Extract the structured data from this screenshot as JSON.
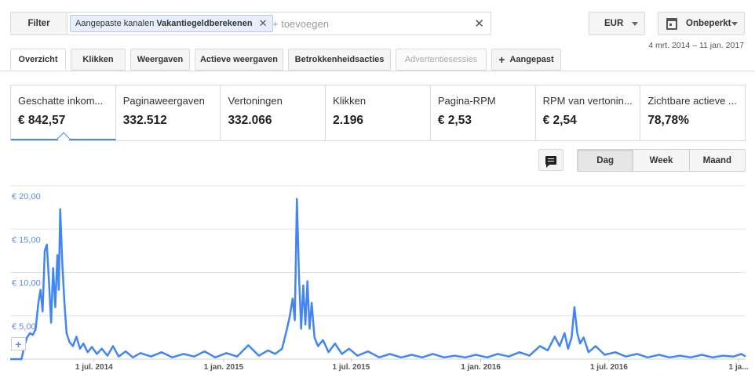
{
  "filter": {
    "button_label": "Filter",
    "chip_prefix": "Aangepaste kanalen",
    "chip_value": "Vakantiegeldberekenen",
    "add_placeholder": "+ toevoegen"
  },
  "currency": {
    "label": "EUR"
  },
  "period": {
    "label": "Onbeperkt",
    "date_range": "4 mrt. 2014 – 11 jan. 2017"
  },
  "tabs": [
    {
      "label": "Overzicht",
      "state": "active"
    },
    {
      "label": "Klikken",
      "state": "normal"
    },
    {
      "label": "Weergaven",
      "state": "normal"
    },
    {
      "label": "Actieve weergaven",
      "state": "normal"
    },
    {
      "label": "Betrokkenheidsacties",
      "state": "normal"
    },
    {
      "label": "Advertentiesessies",
      "state": "disabled"
    },
    {
      "label": "Aangepast",
      "state": "normal"
    }
  ],
  "metrics": [
    {
      "label": "Geschatte inkom...",
      "value": "€ 842,57",
      "selected": true
    },
    {
      "label": "Paginaweergaven",
      "value": "332.512"
    },
    {
      "label": "Vertoningen",
      "value": "332.066"
    },
    {
      "label": "Klikken",
      "value": "2.196"
    },
    {
      "label": "Pagina-RPM",
      "value": "€ 2,53"
    },
    {
      "label": "RPM van vertonin...",
      "value": "€ 2,54"
    },
    {
      "label": "Zichtbare actieve ...",
      "value": "78,78%"
    }
  ],
  "granularity": {
    "options": [
      "Dag",
      "Week",
      "Maand"
    ],
    "selected": "Dag"
  },
  "chart_data": {
    "type": "line",
    "title": "",
    "xlabel": "",
    "ylabel": "",
    "x_start": "2014-03-04",
    "x_end": "2017-01-11",
    "ylim": [
      0,
      20
    ],
    "yticks": [
      "€ 20,00",
      "€ 15,00",
      "€ 10,00",
      "€ 5,00"
    ],
    "ytick_values": [
      20,
      15,
      10,
      5
    ],
    "xticks": [
      {
        "date": "2014-07-01",
        "label": "1 jul. 2014"
      },
      {
        "date": "2015-01-01",
        "label": "1 jan. 2015"
      },
      {
        "date": "2015-07-01",
        "label": "1 jul. 2015"
      },
      {
        "date": "2016-01-01",
        "label": "1 jan. 2016"
      },
      {
        "date": "2016-07-01",
        "label": "1 jul. 2016"
      },
      {
        "date": "2017-01-01",
        "label": "1 ja..."
      }
    ],
    "grid": true,
    "color": "#4285f4",
    "series": [
      {
        "points": [
          [
            "2014-03-04",
            0
          ],
          [
            "2014-03-20",
            0
          ],
          [
            "2014-03-24",
            1.5
          ],
          [
            "2014-03-28",
            2.5
          ],
          [
            "2014-04-01",
            3.0
          ],
          [
            "2014-04-05",
            2.8
          ],
          [
            "2014-04-09",
            3.4
          ],
          [
            "2014-04-13",
            6.5
          ],
          [
            "2014-04-16",
            8.0
          ],
          [
            "2014-04-19",
            5.5
          ],
          [
            "2014-04-22",
            12.5
          ],
          [
            "2014-04-25",
            13.2
          ],
          [
            "2014-04-28",
            9.0
          ],
          [
            "2014-05-01",
            4.2
          ],
          [
            "2014-05-04",
            10.5
          ],
          [
            "2014-05-07",
            6.0
          ],
          [
            "2014-05-10",
            12.0
          ],
          [
            "2014-05-12",
            8.0
          ],
          [
            "2014-05-14",
            17.3
          ],
          [
            "2014-05-17",
            11.0
          ],
          [
            "2014-05-20",
            6.5
          ],
          [
            "2014-05-23",
            3.0
          ],
          [
            "2014-05-27",
            2.0
          ],
          [
            "2014-06-01",
            1.5
          ],
          [
            "2014-06-06",
            2.6
          ],
          [
            "2014-06-11",
            1.2
          ],
          [
            "2014-06-16",
            1.8
          ],
          [
            "2014-06-22",
            0.8
          ],
          [
            "2014-06-28",
            1.4
          ],
          [
            "2014-07-05",
            0.6
          ],
          [
            "2014-07-12",
            1.2
          ],
          [
            "2014-07-20",
            0.4
          ],
          [
            "2014-07-28",
            1.5
          ],
          [
            "2014-08-05",
            0.3
          ],
          [
            "2014-08-15",
            0.9
          ],
          [
            "2014-08-25",
            0.2
          ],
          [
            "2014-09-05",
            0.7
          ],
          [
            "2014-09-20",
            0.3
          ],
          [
            "2014-10-05",
            0.8
          ],
          [
            "2014-10-20",
            0.2
          ],
          [
            "2014-11-05",
            0.6
          ],
          [
            "2014-11-20",
            0.3
          ],
          [
            "2014-12-05",
            0.9
          ],
          [
            "2014-12-20",
            0.2
          ],
          [
            "2015-01-05",
            0.7
          ],
          [
            "2015-01-20",
            0.3
          ],
          [
            "2015-02-05",
            1.6
          ],
          [
            "2015-02-20",
            0.4
          ],
          [
            "2015-03-05",
            1.0
          ],
          [
            "2015-03-15",
            0.6
          ],
          [
            "2015-03-25",
            1.2
          ],
          [
            "2015-04-01",
            3.5
          ],
          [
            "2015-04-05",
            5.0
          ],
          [
            "2015-04-09",
            7.0
          ],
          [
            "2015-04-12",
            4.5
          ],
          [
            "2015-04-15",
            18.5
          ],
          [
            "2015-04-18",
            9.5
          ],
          [
            "2015-04-21",
            3.5
          ],
          [
            "2015-04-24",
            8.5
          ],
          [
            "2015-04-27",
            4.0
          ],
          [
            "2015-04-30",
            9.0
          ],
          [
            "2015-05-03",
            3.5
          ],
          [
            "2015-05-06",
            6.5
          ],
          [
            "2015-05-10",
            2.5
          ],
          [
            "2015-05-15",
            1.5
          ],
          [
            "2015-05-22",
            2.2
          ],
          [
            "2015-05-30",
            0.8
          ],
          [
            "2015-06-08",
            1.8
          ],
          [
            "2015-06-18",
            0.6
          ],
          [
            "2015-06-28",
            1.2
          ],
          [
            "2015-07-10",
            0.4
          ],
          [
            "2015-07-25",
            0.9
          ],
          [
            "2015-08-10",
            0.2
          ],
          [
            "2015-08-25",
            0.6
          ],
          [
            "2015-09-10",
            0.2
          ],
          [
            "2015-09-25",
            0.5
          ],
          [
            "2015-10-10",
            0.2
          ],
          [
            "2015-10-25",
            0.6
          ],
          [
            "2015-11-10",
            0.2
          ],
          [
            "2015-11-25",
            0.4
          ],
          [
            "2015-12-10",
            0.2
          ],
          [
            "2015-12-25",
            0.5
          ],
          [
            "2016-01-10",
            0.2
          ],
          [
            "2016-01-25",
            0.6
          ],
          [
            "2016-02-10",
            0.3
          ],
          [
            "2016-02-25",
            0.8
          ],
          [
            "2016-03-10",
            0.4
          ],
          [
            "2016-03-25",
            1.5
          ],
          [
            "2016-04-05",
            1.0
          ],
          [
            "2016-04-15",
            2.6
          ],
          [
            "2016-04-22",
            1.5
          ],
          [
            "2016-04-29",
            3.0
          ],
          [
            "2016-05-04",
            1.2
          ],
          [
            "2016-05-09",
            2.5
          ],
          [
            "2016-05-13",
            6.0
          ],
          [
            "2016-05-17",
            3.0
          ],
          [
            "2016-05-21",
            1.8
          ],
          [
            "2016-05-26",
            2.5
          ],
          [
            "2016-06-02",
            0.8
          ],
          [
            "2016-06-12",
            1.5
          ],
          [
            "2016-06-25",
            0.5
          ],
          [
            "2016-07-10",
            0.8
          ],
          [
            "2016-07-25",
            0.3
          ],
          [
            "2016-08-10",
            0.6
          ],
          [
            "2016-08-25",
            0.2
          ],
          [
            "2016-09-10",
            0.5
          ],
          [
            "2016-09-25",
            0.2
          ],
          [
            "2016-10-10",
            0.4
          ],
          [
            "2016-10-25",
            0.2
          ],
          [
            "2016-11-10",
            0.5
          ],
          [
            "2016-11-25",
            0.2
          ],
          [
            "2016-12-10",
            0.4
          ],
          [
            "2016-12-25",
            0.3
          ],
          [
            "2017-01-05",
            0.6
          ],
          [
            "2017-01-11",
            0.3
          ]
        ]
      }
    ]
  }
}
